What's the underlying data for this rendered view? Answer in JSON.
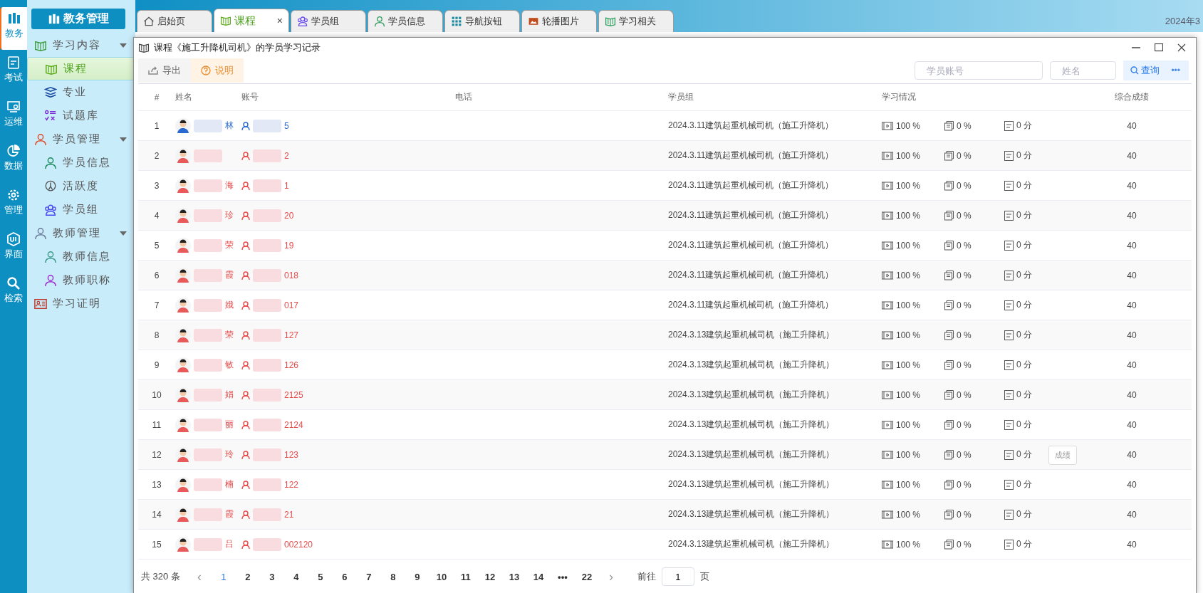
{
  "icon_bar": [
    {
      "label": "教务",
      "selected": true
    },
    {
      "label": "考试",
      "selected": false
    },
    {
      "label": "运维",
      "selected": false
    },
    {
      "label": "数据",
      "selected": false
    },
    {
      "label": "管理",
      "selected": false
    },
    {
      "label": "界面",
      "selected": false
    },
    {
      "label": "检索",
      "selected": false
    }
  ],
  "sidebar": {
    "title": "教务管理",
    "items": [
      {
        "label": "学习内容",
        "expanded": true,
        "selected": false,
        "children": [
          {
            "label": "课程",
            "selected": true
          },
          {
            "label": "专业",
            "selected": false
          },
          {
            "label": "试题库",
            "selected": false
          }
        ]
      },
      {
        "label": "学员管理",
        "expanded": true,
        "selected": false,
        "children": [
          {
            "label": "学员信息",
            "selected": false
          },
          {
            "label": "活跃度",
            "selected": false
          },
          {
            "label": "学员组",
            "selected": false
          }
        ]
      },
      {
        "label": "教师管理",
        "expanded": true,
        "selected": false,
        "children": [
          {
            "label": "教师信息",
            "selected": false
          },
          {
            "label": "教师职称",
            "selected": false
          }
        ]
      },
      {
        "label": "学习证明",
        "selected": false
      }
    ]
  },
  "tabs": [
    {
      "label": "启始页",
      "selected": false
    },
    {
      "label": "课程",
      "selected": true,
      "close": "×"
    },
    {
      "label": "学员组",
      "selected": false
    },
    {
      "label": "学员信息",
      "selected": false
    },
    {
      "label": "导航按钮",
      "selected": false
    },
    {
      "label": "轮播图片",
      "selected": false
    },
    {
      "label": "学习相关",
      "selected": false
    }
  ],
  "date": "2024年3",
  "dialog": {
    "title": "课程《施工升降机司机》的学员学习记录",
    "toolbar": [
      {
        "label": "导出",
        "kind": "export"
      },
      {
        "label": "说明",
        "kind": "help"
      }
    ],
    "search": [
      {
        "placeholder": "学员账号"
      },
      {
        "placeholder": "姓名"
      }
    ],
    "query_button": "查询",
    "more": "•••",
    "table": {
      "columns": [
        "#",
        "姓名",
        "账号",
        "电话",
        "学员组",
        "学习情况",
        "综合成绩"
      ],
      "rows": [
        {
          "index": "1",
          "kind": "male",
          "name": "林",
          "account": "5",
          "group": "2024.3.11建筑起重机械司机（施工升降机）",
          "video": "100 %",
          "exercise": "0 %",
          "exam": "0 分",
          "score": "40"
        },
        {
          "index": "2",
          "kind": "female",
          "account": "2",
          "group": "2024.3.11建筑起重机械司机（施工升降机）",
          "video": "100 %",
          "exercise": "0 %",
          "exam": "0 分",
          "score": "40"
        },
        {
          "index": "3",
          "kind": "female",
          "name": "海",
          "account": "1",
          "group": "2024.3.11建筑起重机械司机（施工升降机）",
          "video": "100 %",
          "exercise": "0 %",
          "exam": "0 分",
          "score": "40"
        },
        {
          "index": "4",
          "kind": "female",
          "name": "珍",
          "account": "20",
          "group": "2024.3.11建筑起重机械司机（施工升降机）",
          "video": "100 %",
          "exercise": "0 %",
          "exam": "0 分",
          "score": "40"
        },
        {
          "index": "5",
          "kind": "female",
          "name": "荣",
          "account": "19",
          "group": "2024.3.11建筑起重机械司机（施工升降机）",
          "video": "100 %",
          "exercise": "0 %",
          "exam": "0 分",
          "score": "40"
        },
        {
          "index": "6",
          "kind": "female",
          "name": "霞",
          "account": "018",
          "group": "2024.3.11建筑起重机械司机（施工升降机）",
          "video": "100 %",
          "exercise": "0 %",
          "exam": "0 分",
          "score": "40"
        },
        {
          "index": "7",
          "kind": "female",
          "name": "娥",
          "account": "017",
          "group": "2024.3.11建筑起重机械司机（施工升降机）",
          "video": "100 %",
          "exercise": "0 %",
          "exam": "0 分",
          "score": "40"
        },
        {
          "index": "8",
          "kind": "female",
          "name": "荣",
          "account": "127",
          "group": "2024.3.13建筑起重机械司机（施工升降机）",
          "video": "100 %",
          "exercise": "0 %",
          "exam": "0 分",
          "score": "40"
        },
        {
          "index": "9",
          "kind": "female",
          "name": "敏",
          "account": "126",
          "group": "2024.3.13建筑起重机械司机（施工升降机）",
          "video": "100 %",
          "exercise": "0 %",
          "exam": "0 分",
          "score": "40"
        },
        {
          "index": "10",
          "kind": "female",
          "name": "娟",
          "account": "2125",
          "group": "2024.3.13建筑起重机械司机（施工升降机）",
          "video": "100 %",
          "exercise": "0 %",
          "exam": "0 分",
          "score": "40"
        },
        {
          "index": "11",
          "kind": "female",
          "name": "丽",
          "account": "2124",
          "group": "2024.3.13建筑起重机械司机（施工升降机）",
          "video": "100 %",
          "exercise": "0 %",
          "exam": "0 分",
          "score": "40"
        },
        {
          "index": "12",
          "kind": "female",
          "name": "玲",
          "account": "123",
          "group": "2024.3.13建筑起重机械司机（施工升降机）",
          "video": "100 %",
          "exercise": "0 %",
          "exam": "0 分",
          "score": "40",
          "tooltip": "成绩"
        },
        {
          "index": "13",
          "kind": "female",
          "name": "楠",
          "account": "122",
          "group": "2024.3.13建筑起重机械司机（施工升降机）",
          "video": "100 %",
          "exercise": "0 %",
          "exam": "0 分",
          "score": "40"
        },
        {
          "index": "14",
          "kind": "female",
          "name": "霞",
          "account": "21",
          "group": "2024.3.13建筑起重机械司机（施工升降机）",
          "video": "100 %",
          "exercise": "0 %",
          "exam": "0 分",
          "score": "40"
        },
        {
          "index": "15",
          "kind": "female",
          "name": "吕",
          "account": "002120",
          "group": "2024.3.13建筑起重机械司机（施工升降机）",
          "video": "100 %",
          "exercise": "0 %",
          "exam": "0 分",
          "score": "40"
        }
      ]
    },
    "pagination": {
      "total": "共 320 条",
      "prev": "‹",
      "next": "›",
      "pages": [
        {
          "label": "1",
          "selected": true
        },
        {
          "label": "2",
          "selected": false
        },
        {
          "label": "3",
          "selected": false
        },
        {
          "label": "4",
          "selected": false
        },
        {
          "label": "5",
          "selected": false
        },
        {
          "label": "6",
          "selected": false
        },
        {
          "label": "7",
          "selected": false
        },
        {
          "label": "8",
          "selected": false
        },
        {
          "label": "9",
          "selected": false
        },
        {
          "label": "10",
          "selected": false
        },
        {
          "label": "11",
          "selected": false
        },
        {
          "label": "12",
          "selected": false
        },
        {
          "label": "13",
          "selected": false
        },
        {
          "label": "14",
          "selected": false
        },
        {
          "label": "•••",
          "selected": false
        },
        {
          "label": "22",
          "selected": false
        }
      ],
      "goto": "前往",
      "goto_value": "1",
      "page_unit": "页"
    }
  }
}
